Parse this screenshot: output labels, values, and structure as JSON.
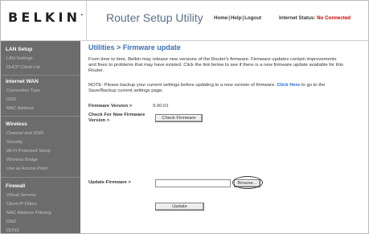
{
  "header": {
    "logo": "BELKIN",
    "logo_mark": ".",
    "title": "Router Setup Utility",
    "links": [
      "Home",
      "Help",
      "Logout"
    ],
    "separator": "|",
    "status_label": "Internet Status:",
    "status_value": "No Connected",
    "status_color": "#cc0000"
  },
  "sidebar": {
    "sections": [
      {
        "title": "LAN Setup",
        "items": [
          "LAN Settings",
          "DHCP Client List"
        ]
      },
      {
        "title": "Internet WAN",
        "items": [
          "Connection Type",
          "DNS",
          "MAC Address"
        ]
      },
      {
        "title": "Wireless",
        "items": [
          "Channel and SSID",
          "Security",
          "Wi-Fi Protected Setup",
          "Wireless Bridge",
          "Use as Access Point"
        ]
      },
      {
        "title": "Firewall",
        "items": [
          "Virtual Servers",
          "Client IP Filters",
          "MAC Address Filtering",
          "DMZ",
          "DDNS"
        ]
      }
    ]
  },
  "main": {
    "title": "Utilities > Firmware update",
    "intro": "From time to time, Belkin may release new versions of the Router's firmware. Firmware updates contain improvements and fixes to problems that may have existed. Click the link below to see if there is a new firmware update available for this Router.",
    "note_before": "NOTE: Please backup your current settings before updating to a new version of firmware.",
    "note_link": "Click Here",
    "note_after": "to go to the Save/Backup current settings page.",
    "firmware_version_label": "Firmware Version >",
    "firmware_version_value": "9.00.01",
    "check_label_line1": "Check For New Firmware",
    "check_label_line2": "Version >",
    "check_button": "Check Firmware",
    "update_label": "Update Firmware >",
    "file_value": "",
    "browse_button": "Browse...",
    "update_button": "Update"
  }
}
